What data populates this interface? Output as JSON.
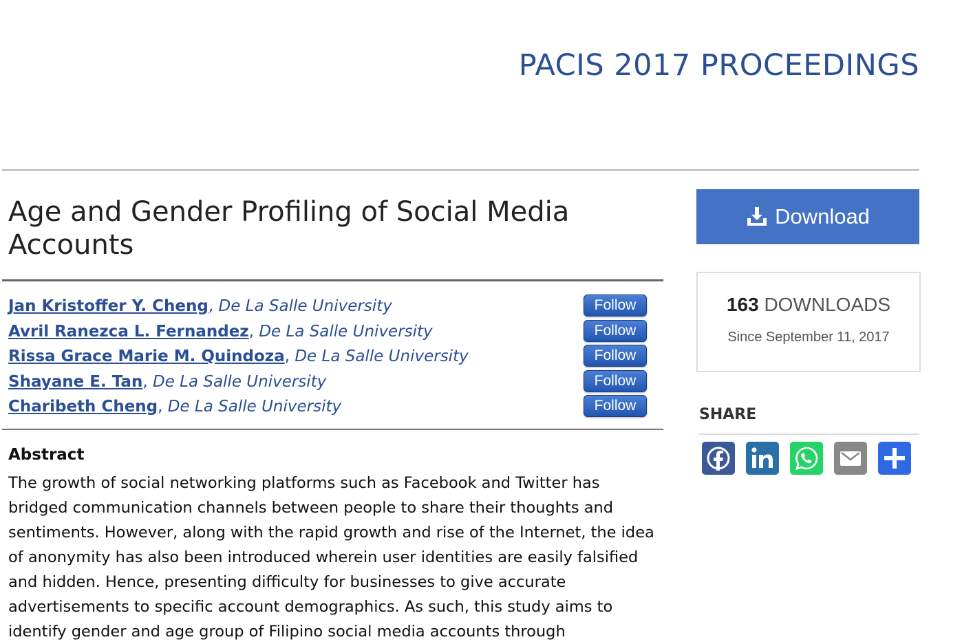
{
  "header": {
    "conference_title": "PACIS 2017 PROCEEDINGS"
  },
  "paper": {
    "title": "Age and Gender Profiling of Social Media Accounts"
  },
  "authors": [
    {
      "name": "Jan Kristoffer Y. Cheng",
      "separator": ", ",
      "affiliation": "De La Salle University",
      "follow_label": "Follow"
    },
    {
      "name": "Avril Ranezca L. Fernandez",
      "separator": ", ",
      "affiliation": "De La Salle University",
      "follow_label": "Follow"
    },
    {
      "name": "Rissa Grace Marie M. Quindoza",
      "separator": ", ",
      "affiliation": "De La Salle University",
      "follow_label": "Follow"
    },
    {
      "name": "Shayane E. Tan",
      "separator": ", ",
      "affiliation": "De La Salle University",
      "follow_label": "Follow"
    },
    {
      "name": "Charibeth Cheng",
      "separator": ", ",
      "affiliation": "De La Salle University",
      "follow_label": "Follow"
    }
  ],
  "abstract": {
    "heading": "Abstract",
    "text": "The growth of social networking platforms such as Facebook and Twitter has bridged communication channels between people to share their thoughts and sentiments. However, along with the rapid growth and rise of the Internet, the idea of anonymity has also been introduced wherein user identities are easily falsified and hidden. Hence, presenting difficulty for businesses to give accurate advertisements to specific account demographics. As such, this study aims to identify gender and age group of Filipino social media accounts through"
  },
  "sidebar": {
    "download_label": "Download",
    "downloads_count": "163",
    "downloads_label": " DOWNLOADS",
    "since": "Since September 11, 2017",
    "share_heading": "SHARE",
    "share_icons": [
      "facebook-icon",
      "linkedin-icon",
      "whatsapp-icon",
      "email-icon",
      "share-plus-icon"
    ]
  },
  "colors": {
    "brand_blue": "#2b4f94",
    "download_blue": "#4472c4",
    "facebook": "#3b5998",
    "linkedin": "#2b6fa8",
    "whatsapp": "#25d366",
    "email": "#888888",
    "share": "#2f6ae4"
  }
}
